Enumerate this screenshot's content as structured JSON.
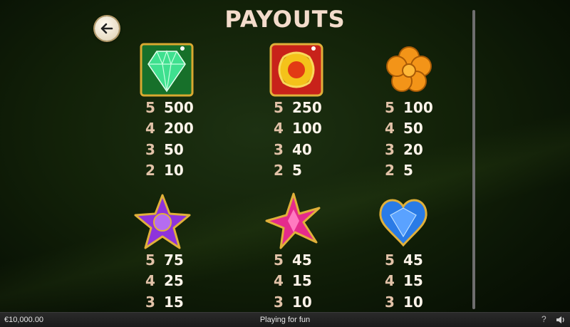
{
  "title": "PAYOUTS",
  "back_button": {
    "icon": "arrow-left-icon"
  },
  "symbols": [
    {
      "id": "diamond",
      "icon": "green-diamond-icon",
      "color": "#2fd07a",
      "payouts": [
        {
          "count": "5",
          "value": "500"
        },
        {
          "count": "4",
          "value": "200"
        },
        {
          "count": "3",
          "value": "50"
        },
        {
          "count": "2",
          "value": "10"
        }
      ]
    },
    {
      "id": "ruby-ring",
      "icon": "red-yellow-gem-icon",
      "color": "#e52a1f",
      "payouts": [
        {
          "count": "5",
          "value": "250"
        },
        {
          "count": "4",
          "value": "100"
        },
        {
          "count": "3",
          "value": "40"
        },
        {
          "count": "2",
          "value": "5"
        }
      ]
    },
    {
      "id": "amber-flower",
      "icon": "orange-flower-gem-icon",
      "color": "#f08a12",
      "payouts": [
        {
          "count": "5",
          "value": "100"
        },
        {
          "count": "4",
          "value": "50"
        },
        {
          "count": "3",
          "value": "20"
        },
        {
          "count": "2",
          "value": "5"
        }
      ]
    },
    {
      "id": "purple-star",
      "icon": "purple-star-gem-icon",
      "color": "#8a2fd6",
      "payouts": [
        {
          "count": "5",
          "value": "75"
        },
        {
          "count": "4",
          "value": "25"
        },
        {
          "count": "3",
          "value": "15"
        }
      ]
    },
    {
      "id": "pink-star",
      "icon": "pink-star-gem-icon",
      "color": "#e0268a",
      "payouts": [
        {
          "count": "5",
          "value": "45"
        },
        {
          "count": "4",
          "value": "15"
        },
        {
          "count": "3",
          "value": "10"
        }
      ]
    },
    {
      "id": "blue-heart",
      "icon": "blue-heart-gem-icon",
      "color": "#2a7be6",
      "payouts": [
        {
          "count": "5",
          "value": "45"
        },
        {
          "count": "4",
          "value": "15"
        },
        {
          "count": "3",
          "value": "10"
        }
      ]
    }
  ],
  "footer": {
    "balance": "€10,000.00",
    "mode": "Playing for fun",
    "help_label": "?",
    "help_icon": "help-icon",
    "sound_icon": "speaker-icon"
  }
}
